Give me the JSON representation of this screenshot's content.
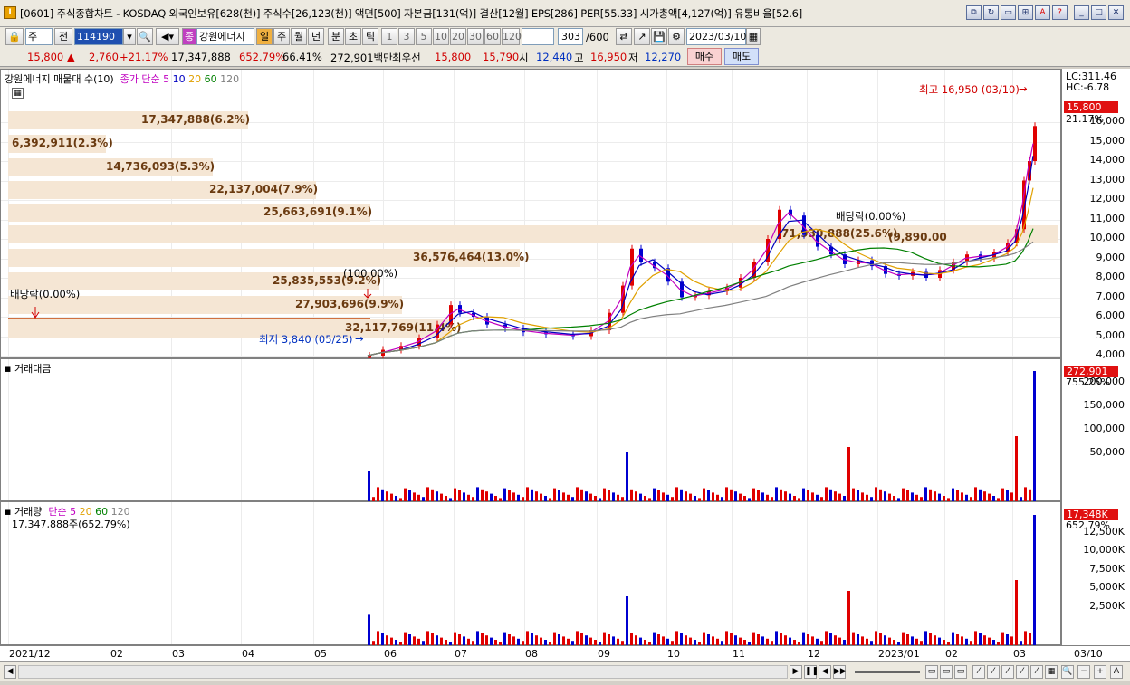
{
  "window": {
    "title": "[0601] 주식종합차트 - KOSDAQ 외국인보유[628(천)] 주식수[26,123(천)] 액면[500] 자본금[131(억)] 결산[12월] EPS[286] PER[55.33] 시가총액[4,127(억)] 유통비율[52.6]",
    "app_icon": "I"
  },
  "toolbar1": {
    "mode_label": "주",
    "prev_label": "전",
    "code_value": "114190",
    "stock_name": "강원에너지",
    "stock_badge": "종",
    "periods": [
      "일",
      "주",
      "월",
      "년",
      "분",
      "초",
      "틱"
    ],
    "numbers": [
      "1",
      "3",
      "5",
      "10",
      "20",
      "30",
      "60",
      "120"
    ],
    "count_value": "303",
    "count_total": "/600",
    "date_value": "2023/03/10"
  },
  "quote": {
    "price": "15,800",
    "change": "2,760",
    "change_pct": "+21.17%",
    "volume": "17,347,888",
    "volume_ratio": "652.79%",
    "other_pct": "66.41%",
    "trade_value": "272,901백만",
    "cb_label": "최우선",
    "ask": "15,800",
    "bid": "15,790",
    "open_label": "시",
    "open": "12,440",
    "high_label": "고",
    "high": "16,950",
    "low_label": "저",
    "low": "12,270",
    "buy_label": "매수",
    "sell_label": "매도"
  },
  "price_panel": {
    "legend_title": "강원에너지 매물대 수(10)",
    "ma_label": "종가 단순",
    "ma_periods": [
      "5",
      "10",
      "20",
      "60",
      "120"
    ],
    "ma_colors": [
      "#c000c0",
      "#0000c0",
      "#e0a000",
      "#008000",
      "#808080"
    ],
    "lc_text": "LC:311.46",
    "hc_text": "HC:-6.78",
    "price_tag": "15,800",
    "pct_tag": "21.17%",
    "ticks": [
      "16,000",
      "15,000",
      "14,000",
      "13,000",
      "12,000",
      "11,000",
      "10,000",
      "9,000",
      "8,000",
      "7,000",
      "6,000",
      "5,000",
      "4,000"
    ],
    "high_annotation": "최고 16,950 (03/10)",
    "low_annotation": "최저 3,840 (05/25)",
    "dividend1": "배당락(0.00%)",
    "dividend2": "배당락(0.00%)",
    "split": "(100.00%)",
    "volume_profile": [
      {
        "label": "17,347,888(6.2%)"
      },
      {
        "label": "6,392,911(2.3%)"
      },
      {
        "label": "14,736,093(5.3%)"
      },
      {
        "label": "22,137,004(7.9%)"
      },
      {
        "label": "25,663,691(9.1%)"
      },
      {
        "label": "71,930,888(25.6%)"
      },
      {
        "label": "36,576,464(13.0%)"
      },
      {
        "label": "25,835,553(9.2%)"
      },
      {
        "label": "27,903,696(9.9%)"
      },
      {
        "label": "32,117,769(11.4%)"
      }
    ],
    "extra_label": "(9,890.00"
  },
  "value_panel": {
    "legend_title": "거래대금",
    "tag_value": "272,901",
    "tag_pct": "755.25%",
    "ticks": [
      "200,000",
      "150,000",
      "100,000",
      "50,000"
    ]
  },
  "volume_panel": {
    "legend_title": "거래량",
    "ma_label": "단순",
    "ma_periods": [
      "5",
      "20",
      "60",
      "120"
    ],
    "sub_label": "17,347,888주(652.79%)",
    "tag_value": "17,348K",
    "tag_pct": "652.79%",
    "ticks": [
      "12,500K",
      "10,000K",
      "7,500K",
      "5,000K",
      "2,500K"
    ]
  },
  "xaxis": {
    "labels": [
      "2021/12",
      "02",
      "03",
      "04",
      "05",
      "06",
      "07",
      "08",
      "09",
      "10",
      "11",
      "12",
      "2023/01",
      "02",
      "03"
    ],
    "end_label": "03/10"
  },
  "colors": {
    "up": "#e00000",
    "down": "#0000d0",
    "profile": "#f5e6d4"
  }
}
